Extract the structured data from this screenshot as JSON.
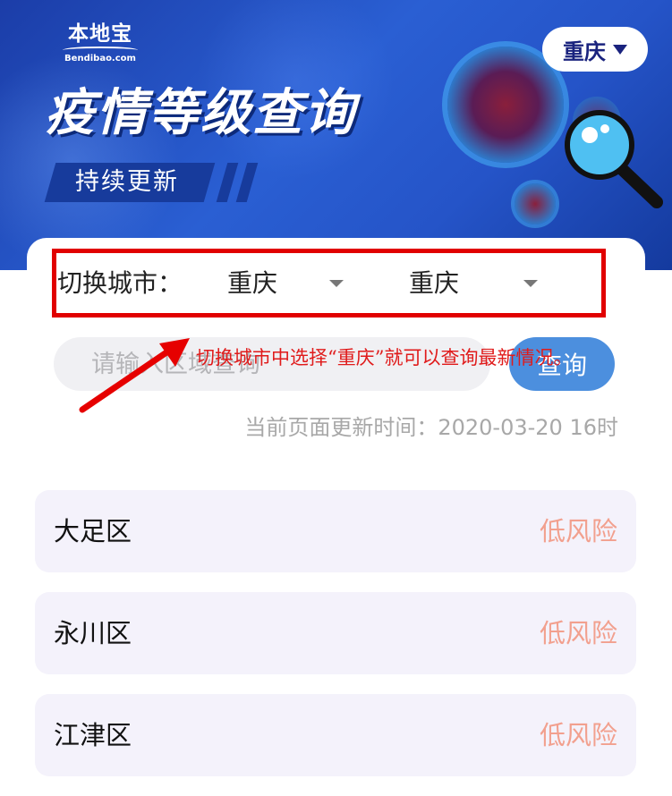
{
  "header": {
    "logo_main": "本地宝",
    "logo_sub": "Bendibao.com",
    "title": "疫情等级查询",
    "subtitle": "持续更新",
    "city_pill": "重庆"
  },
  "switcher": {
    "label": "切换城市：",
    "province": "重庆",
    "city": "重庆"
  },
  "search": {
    "placeholder": "请输入区域查询",
    "button": "查询"
  },
  "annotation": "切换城市中选择“重庆”就可以查询最新情况。",
  "update_time": "当前页面更新时间：2020-03-20 16时",
  "districts": [
    {
      "name": "大足区",
      "risk": "低风险"
    },
    {
      "name": "永川区",
      "risk": "低风险"
    },
    {
      "name": "江津区",
      "risk": "低风险"
    }
  ],
  "colors": {
    "banner": "#2554c8",
    "accent_button": "#4c8fde",
    "risk_low": "#f2a08e",
    "annotation": "#e01b1b",
    "highlight": "#e10000"
  }
}
